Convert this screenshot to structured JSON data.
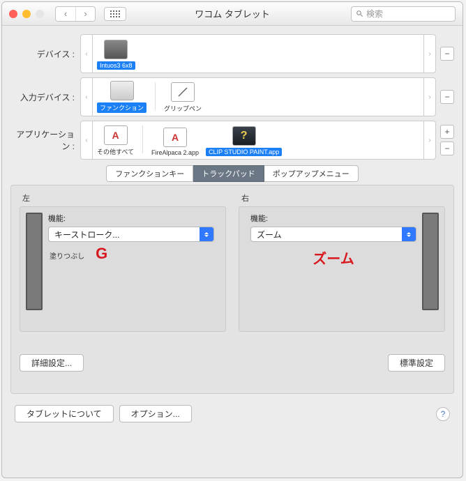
{
  "window": {
    "title": "ワコム タブレット",
    "search_placeholder": "検索"
  },
  "rows": {
    "device": {
      "label": "デバイス :",
      "items": [
        {
          "label": "Intuos3 6x8"
        }
      ]
    },
    "input_device": {
      "label": "入力デバイス :",
      "items": [
        {
          "label": "ファンクション"
        },
        {
          "label": "グリップペン"
        }
      ]
    },
    "application": {
      "label": "アプリケーション :",
      "items": [
        {
          "label": "その他すべて"
        },
        {
          "label": "FireAlpaca 2.app"
        },
        {
          "label": "CLIP STUDIO PAINT.app"
        }
      ]
    }
  },
  "tabs": {
    "t1": "ファンクションキー",
    "t2": "トラックパッド",
    "t3": "ポップアップメニュー"
  },
  "panel": {
    "left_title": "左",
    "right_title": "右",
    "function_label": "機能:",
    "left_select": "キーストローク...",
    "left_sublabel": "塗りつぶし",
    "left_highlight": "G",
    "right_select": "ズーム",
    "right_highlight": "ズーム",
    "advanced": "詳細設定...",
    "default": "標準設定"
  },
  "footer": {
    "about": "タブレットについて",
    "options": "オプション...",
    "help": "?"
  }
}
